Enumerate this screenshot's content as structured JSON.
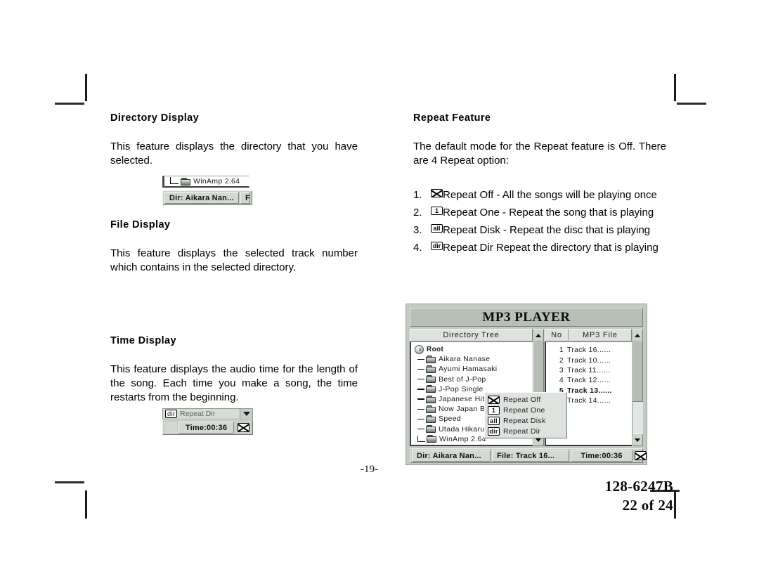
{
  "page": {
    "page_number": "-19-",
    "doc_code": "128-6247B",
    "sheet": "22 of 24"
  },
  "left_column": {
    "directory_display": {
      "heading": "Directory  Display",
      "body": "This feature displays the directory that you have selected."
    },
    "directory_snippet": {
      "tree_label": "WinAmp 2.64",
      "status_dir": "Dir: Aikara Nan..."
    },
    "file_display": {
      "heading": "File  Display",
      "body": "This feature displays the selected track number which contains in  the selected directory."
    },
    "time_display": {
      "heading": "Time Display",
      "body": "This feature displays the audio time for the length of the  song.  Each time you make a song, the time restarts from the beginning."
    },
    "time_snippet": {
      "repeat_label": "Repeat Dir",
      "status_time": "Time:00:36"
    }
  },
  "right_column": {
    "repeat_feature": {
      "heading": "Repeat  Feature",
      "body": "The default mode for the Repeat feature is Off. There are 4 Repeat option:",
      "options": [
        {
          "num": "1.",
          "icon": "repeat-off-icon",
          "icon_text": "",
          "text": "Repeat Off -  All the songs will be playing once"
        },
        {
          "num": "2.",
          "icon": "repeat-one-icon",
          "icon_text": "1",
          "text": "Repeat One - Repeat the song that is playing"
        },
        {
          "num": "3.",
          "icon": "repeat-disk-icon",
          "icon_text": "all",
          "text": "Repeat Disk - Repeat the disc that is playing"
        },
        {
          "num": "4.",
          "icon": "repeat-dir-icon",
          "icon_text": "dir",
          "text": "Repeat Dir  Repeat the directory that is playing"
        }
      ]
    }
  },
  "mp3_window": {
    "title": "MP3 PLAYER",
    "tree_header": "Directory Tree",
    "no_header": "No",
    "file_header": "MP3 File",
    "tree_items": [
      {
        "label": "Root",
        "type": "disc"
      },
      {
        "label": "Aikara Nanase",
        "type": "folder-open"
      },
      {
        "label": "Ayumi Hamasaki",
        "type": "folder"
      },
      {
        "label": "Best of J-Pop",
        "type": "folder"
      },
      {
        "label": "J-Pop Single",
        "type": "folder"
      },
      {
        "label": "Japanese Hit 2000",
        "type": "folder"
      },
      {
        "label": "Now Japan Best",
        "type": "folder"
      },
      {
        "label": "Speed",
        "type": "folder"
      },
      {
        "label": "Utada Hikaru",
        "type": "folder"
      },
      {
        "label": "WinAmp 2.64",
        "type": "folder"
      }
    ],
    "file_rows": [
      {
        "no": "1",
        "name": "Track 16......",
        "selected": false
      },
      {
        "no": "2",
        "name": "Track 10......",
        "selected": false
      },
      {
        "no": "3",
        "name": "Track 11......",
        "selected": false
      },
      {
        "no": "4",
        "name": "Track 12......",
        "selected": false
      },
      {
        "no": "5",
        "name": "Track 13......",
        "selected": true
      },
      {
        "no": "6",
        "name": "Track 14......",
        "selected": false
      }
    ],
    "repeat_menu": [
      {
        "icon": "repeat-off-icon",
        "icon_text": "",
        "label": "Repeat Off"
      },
      {
        "icon": "repeat-one-icon",
        "icon_text": "1",
        "label": "Repeat One"
      },
      {
        "icon": "repeat-disk-icon",
        "icon_text": "all",
        "label": "Repeat Disk"
      },
      {
        "icon": "repeat-dir-icon",
        "icon_text": "dir",
        "label": "Repeat Dir"
      }
    ],
    "status": {
      "dir": "Dir: Aikara Nan...",
      "file": "File: Track 16...",
      "time": "Time:00:36"
    }
  }
}
